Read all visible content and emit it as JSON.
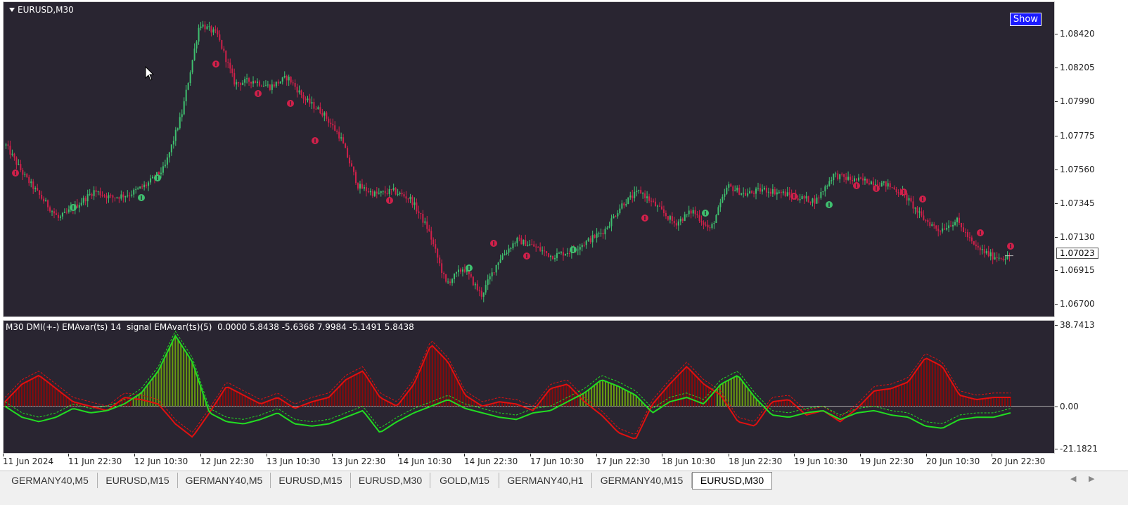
{
  "chart_header": {
    "symbol": "EURUSD,M30",
    "show_button": "Show"
  },
  "indicator": {
    "label": "M30 DMI(+-) EMAvar(ts) 14  signal EMAvar(ts)(5)  0.0000 5.8438 -5.6368 7.9984 -5.1491 5.8438",
    "scale_top": "38.7413",
    "scale_zero": "0.00",
    "scale_bottom": "-21.1821"
  },
  "price_scale": {
    "ticks": [
      "1.08420",
      "1.08205",
      "1.07990",
      "1.07775",
      "1.07560",
      "1.07345",
      "1.07130",
      "1.06915",
      "1.06700"
    ],
    "current_price": "1.07023"
  },
  "time_axis": {
    "labels": [
      "11 Jun 2024",
      "11 Jun 22:30",
      "12 Jun 10:30",
      "12 Jun 22:30",
      "13 Jun 10:30",
      "13 Jun 22:30",
      "14 Jun 10:30",
      "14 Jun 22:30",
      "17 Jun 10:30",
      "17 Jun 22:30",
      "18 Jun 10:30",
      "18 Jun 22:30",
      "19 Jun 10:30",
      "19 Jun 22:30",
      "20 Jun 10:30",
      "20 Jun 22:30"
    ]
  },
  "tabs": [
    {
      "label": "GERMANY40,M5",
      "active": false
    },
    {
      "label": "EURUSD,M15",
      "active": false
    },
    {
      "label": "GERMANY40,M5",
      "active": false
    },
    {
      "label": "EURUSD,M15",
      "active": false
    },
    {
      "label": "EURUSD,M30",
      "active": false
    },
    {
      "label": "GOLD,M15",
      "active": false
    },
    {
      "label": "GERMANY40,H1",
      "active": false
    },
    {
      "label": "GERMANY40,M15",
      "active": false
    },
    {
      "label": "EURUSD,M30",
      "active": true
    }
  ],
  "colors": {
    "background": "#292531",
    "bull": "#3fbf6f",
    "bear": "#d0204a",
    "dmi_plus": "#22dd22",
    "dmi_minus": "#e01010",
    "hist_plus": "#6a9a10",
    "hist_minus": "#8a0a0a"
  },
  "chart_data": [
    {
      "type": "candlestick",
      "title": "EURUSD,M30",
      "ylim": [
        1.0665,
        1.0858
      ],
      "x": [
        "11 Jun 2024",
        "11 Jun 22:30",
        "12 Jun 10:30",
        "12 Jun 22:30",
        "13 Jun 10:30",
        "13 Jun 22:30",
        "14 Jun 10:30",
        "14 Jun 22:30",
        "17 Jun 10:30",
        "17 Jun 22:30",
        "18 Jun 10:30",
        "18 Jun 22:30",
        "19 Jun 10:30",
        "19 Jun 22:30",
        "20 Jun 10:30",
        "20 Jun 22:30"
      ],
      "close_path": [
        1.077,
        1.0752,
        1.0738,
        1.0725,
        1.0733,
        1.0742,
        1.0738,
        1.074,
        1.0746,
        1.0756,
        1.079,
        1.0845,
        1.0838,
        1.0808,
        1.081,
        1.0806,
        1.0812,
        1.0798,
        1.079,
        1.0775,
        1.0745,
        1.074,
        1.0742,
        1.0737,
        1.0718,
        1.0685,
        1.0695,
        1.0678,
        1.07,
        1.0712,
        1.0708,
        1.0702,
        1.0705,
        1.0711,
        1.0718,
        1.0734,
        1.0742,
        1.0732,
        1.0722,
        1.073,
        1.0718,
        1.0745,
        1.074,
        1.0743,
        1.0741,
        1.0738,
        1.0736,
        1.0752,
        1.0749,
        1.0748,
        1.0746,
        1.074,
        1.0726,
        1.0718,
        1.0724,
        1.0708,
        1.0702,
        1.0701
      ],
      "last_price": 1.07023
    },
    {
      "type": "line",
      "title": "M30 DMI(+-) EMAvar(ts) 14  signal EMAvar(ts)(5)",
      "ylim": [
        -21.1821,
        38.7413
      ],
      "series": [
        {
          "name": "DMI+",
          "values": [
            0,
            -5,
            -7,
            -5,
            -1,
            -3,
            -2,
            1,
            6,
            16,
            32,
            20,
            -3,
            -7,
            -8,
            -6,
            -3,
            -8,
            -9,
            -8,
            -5,
            -2,
            -12,
            -7,
            -3,
            0,
            3,
            -1,
            -3,
            -5,
            -6,
            -3,
            -2,
            2,
            6,
            12,
            9,
            5,
            -3,
            2,
            4,
            1,
            10,
            14,
            4,
            -4,
            -5,
            -3,
            -2,
            -6,
            -3,
            -2,
            -4,
            -5,
            -9,
            -10,
            -6,
            -5,
            -5,
            -3
          ]
        },
        {
          "name": "DMI-",
          "values": [
            2,
            10,
            14,
            8,
            2,
            0,
            -2,
            4,
            3,
            1,
            -8,
            -14,
            -3,
            9,
            5,
            1,
            4,
            -1,
            2,
            4,
            12,
            16,
            4,
            0,
            10,
            28,
            20,
            5,
            0,
            2,
            1,
            -2,
            8,
            10,
            2,
            -4,
            -12,
            -15,
            1,
            10,
            18,
            10,
            5,
            -7,
            -9,
            2,
            3,
            -4,
            -2,
            -7,
            -1,
            7,
            8,
            11,
            22,
            18,
            5,
            3,
            4,
            4
          ]
        },
        {
          "name": "signal",
          "values": [
            5.8438,
            -5.6368,
            7.9984,
            -5.1491,
            5.8438
          ]
        }
      ]
    }
  ]
}
